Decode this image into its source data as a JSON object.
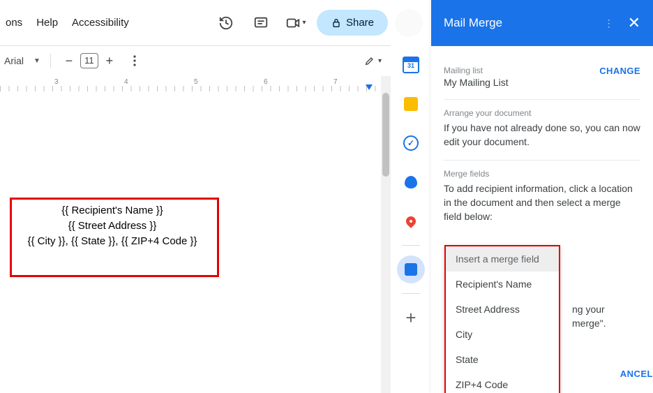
{
  "menu": {
    "ons": "ons",
    "help": "Help",
    "accessibility": "Accessibility"
  },
  "toolbar": {
    "font": "Arial",
    "size": "11",
    "share": "Share"
  },
  "ruler": {
    "n1": "3",
    "n2": "4",
    "n3": "5",
    "n4": "6",
    "n5": "7"
  },
  "doc": {
    "line1": "{{ Recipient's Name }}",
    "line2": "{{ Street Address }}",
    "line3": "{{ City }}, {{ State }}, {{ ZIP+4 Code }}"
  },
  "mm": {
    "title": "Mail Merge",
    "mailing_label": "Mailing list",
    "mailing_value": "My Mailing List",
    "change": "CHANGE",
    "arrange_label": "Arrange your document",
    "arrange_text": "If you have not already done so, you can now edit your document.",
    "fields_label": "Merge fields",
    "fields_text": "To add recipient information, click a location in the document and then select a merge field below:",
    "dd_head": "Insert a merge field",
    "dd1": "Recipient's Name",
    "dd2": "Street Address",
    "dd3": "City",
    "dd4": "State",
    "dd5": "ZIP+4 Code",
    "tail1": "ng your",
    "tail2": " merge\".",
    "cancel": "ANCEL"
  }
}
